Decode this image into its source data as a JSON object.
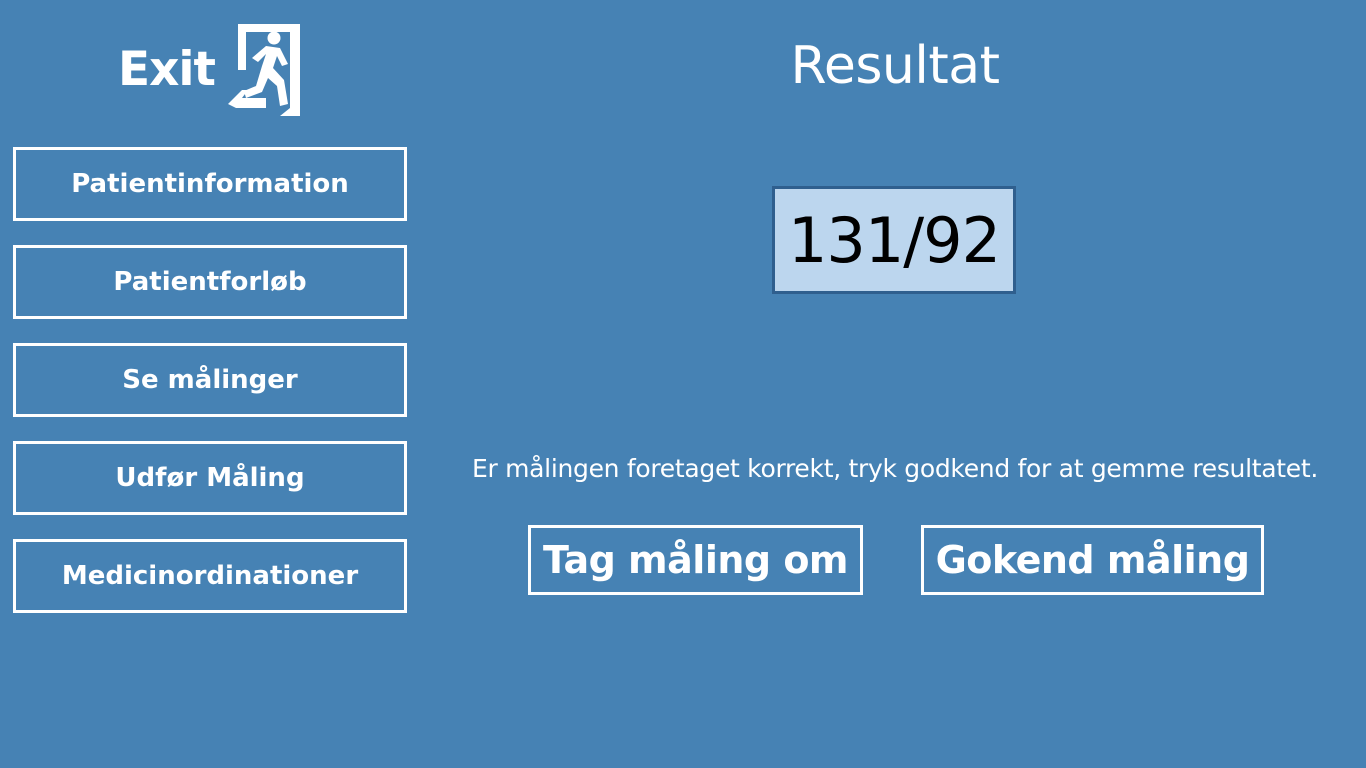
{
  "exit": {
    "label": "Exit",
    "icon": "emergency-exit-running-man-icon"
  },
  "sidebar": {
    "items": [
      {
        "label": "Patientinformation"
      },
      {
        "label": "Patientforløb"
      },
      {
        "label": "Se målinger"
      },
      {
        "label": "Udfør Måling"
      },
      {
        "label": "Medicinordinationer"
      }
    ]
  },
  "main": {
    "title": "Resultat",
    "result_value": "131/92",
    "instruction": "Er målingen foretaget korrekt, tryk godkend for at gemme resultatet.",
    "buttons": {
      "retake_label": "Tag måling om",
      "approve_label": "Gokend måling"
    }
  },
  "colors": {
    "background": "#4682b4",
    "result_box_bg": "#bcd6ee",
    "result_box_border": "#2f5f8e",
    "text": "#ffffff"
  }
}
